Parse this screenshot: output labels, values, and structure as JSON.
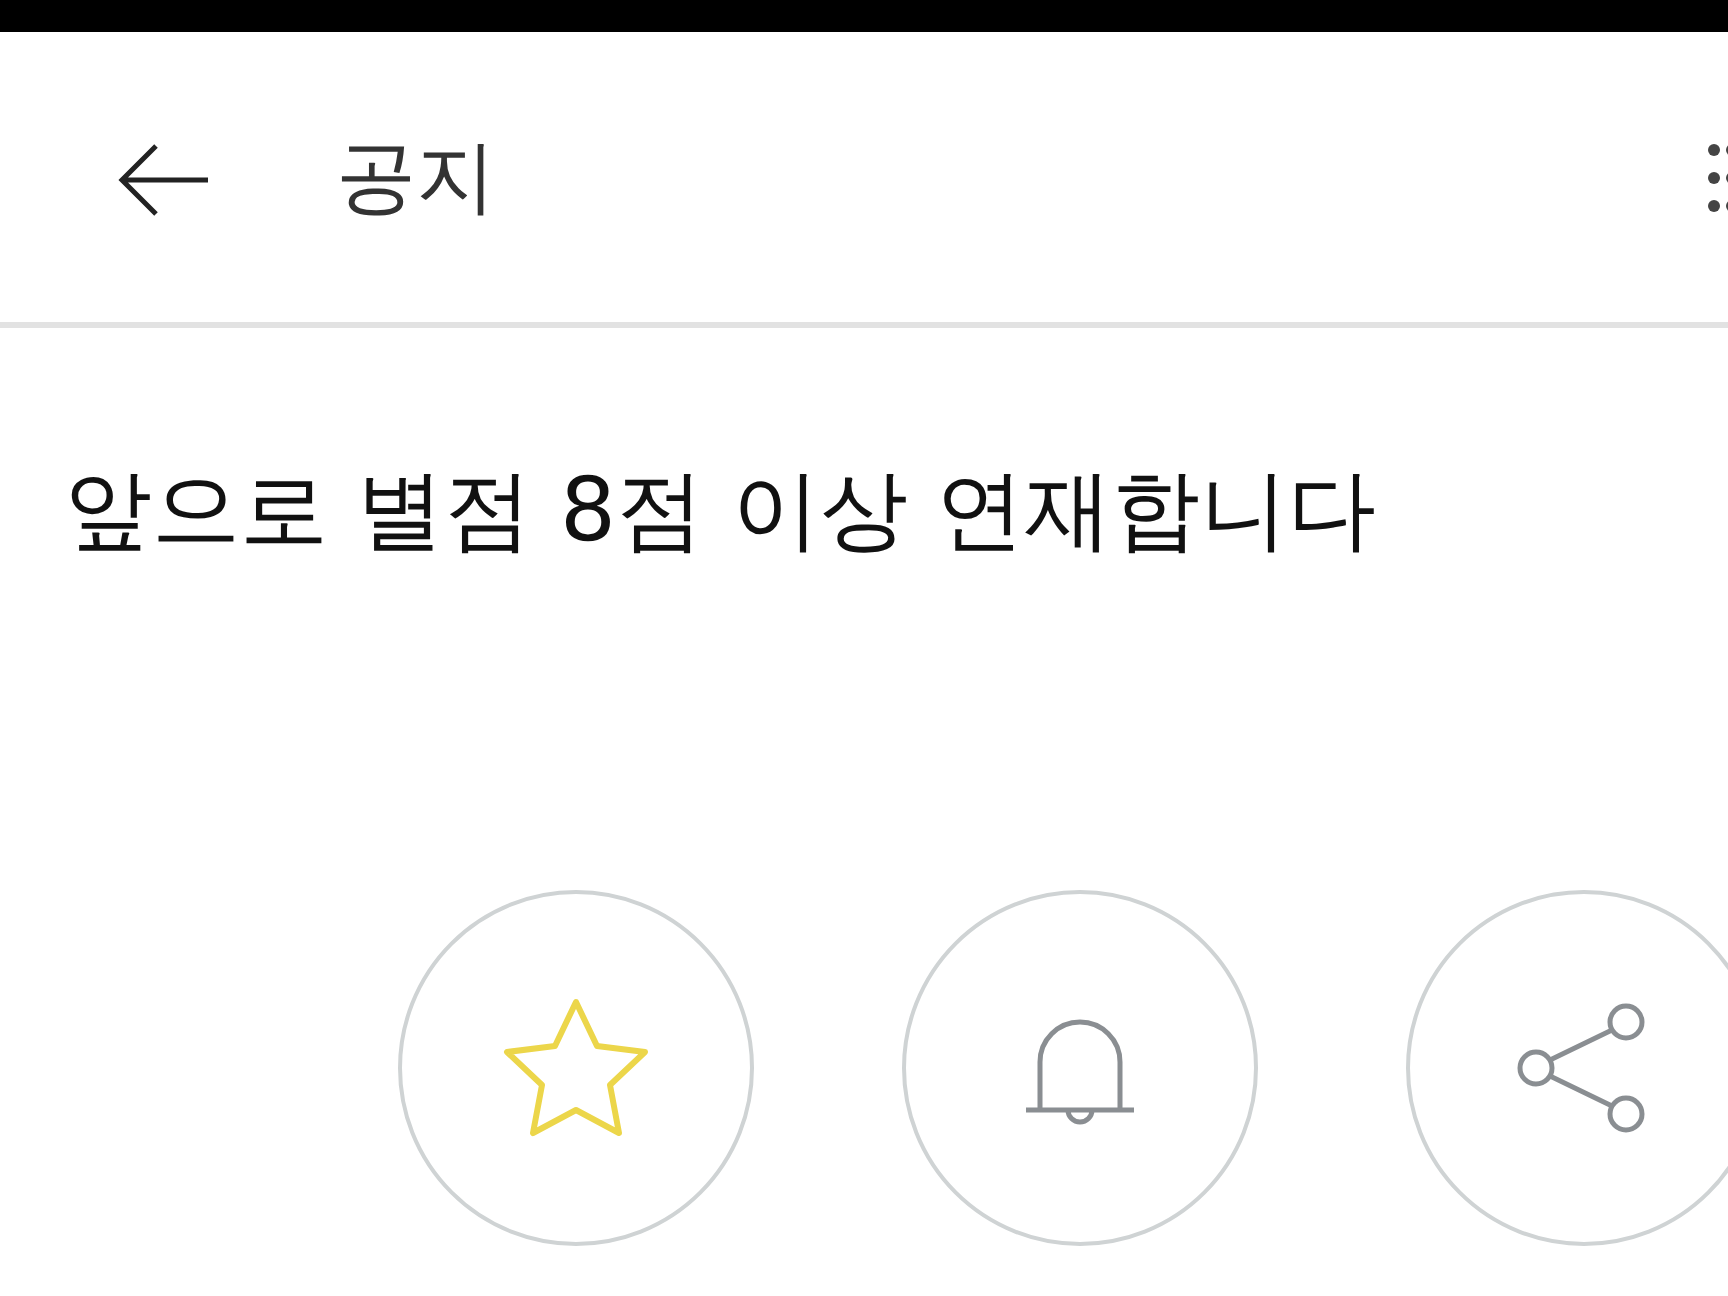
{
  "header": {
    "title": "공지"
  },
  "post": {
    "title": "앞으로 별점 8점 이상 연재합니다"
  },
  "actions": [
    {
      "kind": "favorite"
    },
    {
      "kind": "notify"
    },
    {
      "kind": "share"
    }
  ]
}
